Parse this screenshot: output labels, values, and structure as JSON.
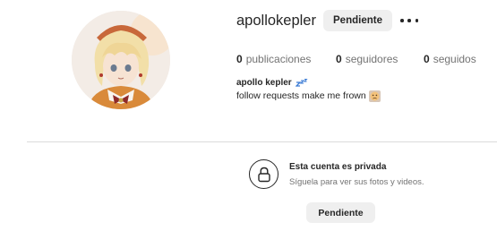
{
  "profile": {
    "username": "apollokepler",
    "pending_label": "Pendiente",
    "stats": {
      "posts_count": "0",
      "posts_label": "publicaciones",
      "followers_count": "0",
      "followers_label": "seguidores",
      "following_count": "0",
      "following_label": "seguidos"
    },
    "full_name": "apollo kepler",
    "bio": "follow requests make me frown"
  },
  "private_notice": {
    "title": "Esta cuenta es privada",
    "subtitle": "Síguela para ver sus fotos y videos.",
    "pending_label": "Pendiente"
  },
  "icons": {
    "more": "more-options-icon",
    "lock": "lock-icon",
    "zzz": "zzz-emoji",
    "frown": "frowning-emoji"
  }
}
